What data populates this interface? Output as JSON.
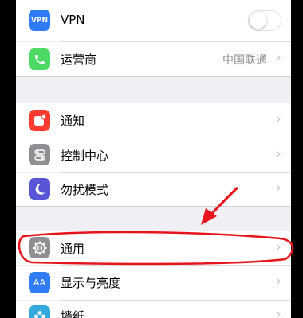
{
  "rows": {
    "vpn": {
      "label": "VPN",
      "icon_text": "VPN",
      "icon": "vpn-icon",
      "toggle_on": false,
      "color": "#2f7cf6"
    },
    "carrier": {
      "label": "运营商",
      "value": "中国联通",
      "icon": "phone-icon",
      "color": "#4cd964"
    },
    "notifications": {
      "label": "通知",
      "icon": "notification-icon",
      "color": "#ff3b30"
    },
    "control_center": {
      "label": "控制中心",
      "icon": "control-center-icon",
      "color": "#8e8e93"
    },
    "dnd": {
      "label": "勿扰模式",
      "icon": "moon-icon",
      "color": "#5856d6"
    },
    "general": {
      "label": "通用",
      "icon": "gear-icon",
      "color": "#8e8e93"
    },
    "display": {
      "label": "显示与亮度",
      "icon_text": "AA",
      "icon": "display-icon",
      "color": "#2f7cf6"
    },
    "wallpaper": {
      "label": "墙纸",
      "icon": "wallpaper-icon",
      "color": "#34aadc"
    }
  },
  "chevron": "›",
  "annotation": {
    "color": "#e8141b"
  }
}
